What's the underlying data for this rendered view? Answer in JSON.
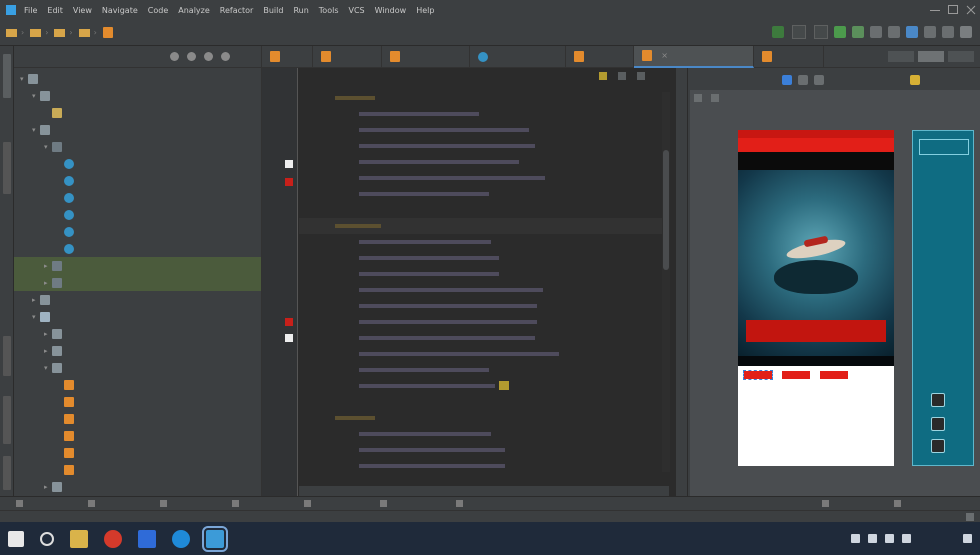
{
  "window": {
    "menu": [
      "File",
      "Edit",
      "View",
      "Navigate",
      "Code",
      "Analyze",
      "Refactor",
      "Build",
      "Run",
      "Tools",
      "VCS",
      "Window",
      "Help"
    ]
  },
  "colors": {
    "ide_bg": "#2b2b2b",
    "panel_bg": "#3c3f41",
    "accent_red": "#e21f18",
    "blueprint": "#0f6c82",
    "taskbar": "#1f2a3a"
  },
  "icons": [
    "android-icon",
    "folder-icon",
    "package-icon",
    "xml-file-icon",
    "java-class-icon",
    "breakpoint-icon",
    "run-icon",
    "debug-icon",
    "sync-icon",
    "search-icon",
    "windows-start-icon"
  ]
}
